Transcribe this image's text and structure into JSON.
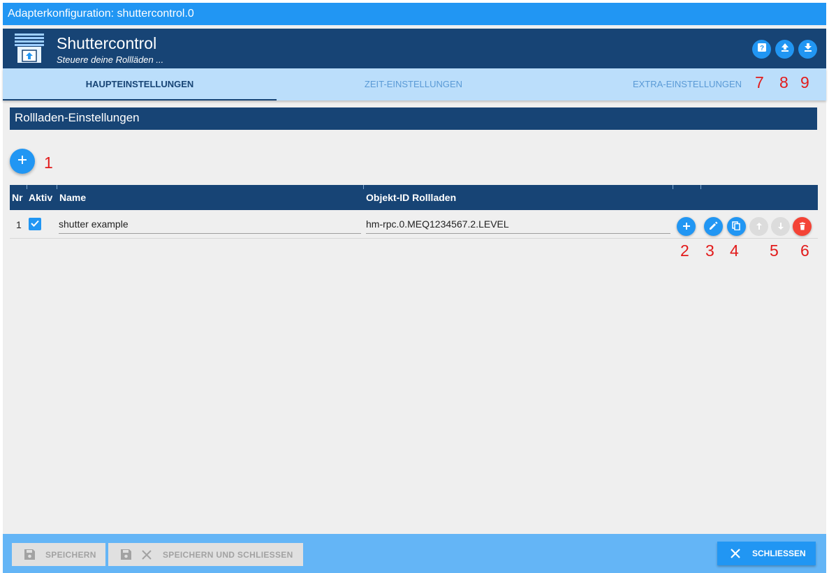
{
  "window": {
    "title": "Adapterkonfiguration: shuttercontrol.0"
  },
  "header": {
    "title": "Shuttercontrol",
    "subtitle": "Steuere deine Rollläden ...",
    "buttons": [
      {
        "icon": "help-icon"
      },
      {
        "icon": "upload-icon"
      },
      {
        "icon": "download-icon"
      }
    ]
  },
  "tabs": [
    {
      "label": "HAUPTEINSTELLUNGEN",
      "active": true
    },
    {
      "label": "ZEIT-EINSTELLUNGEN",
      "active": false
    },
    {
      "label": "EXTRA-EINSTELLUNGEN",
      "active": false
    }
  ],
  "section": {
    "title": "Rollladen-Einstellungen"
  },
  "table": {
    "headers": {
      "nr": "Nr",
      "aktiv": "Aktiv",
      "name": "Name",
      "objekt": "Objekt-ID Rollladen"
    },
    "rows": [
      {
        "nr": "1",
        "aktiv": true,
        "name": "shutter example",
        "objekt": "hm-rpc.0.MEQ1234567.2.LEVEL"
      }
    ]
  },
  "markers": [
    "1",
    "2",
    "3",
    "4",
    "5",
    "6",
    "7",
    "8",
    "9"
  ],
  "footer": {
    "save_label": "SPEICHERN",
    "save_close_label": "SPEICHERN UND SCHLIESSEN",
    "close_label": "SCHLIESSEN"
  },
  "colors": {
    "accent": "#2196f3",
    "header": "#174475",
    "tabbar": "#bbdefb",
    "delete": "#f44336",
    "marker": "#e21b1b"
  }
}
